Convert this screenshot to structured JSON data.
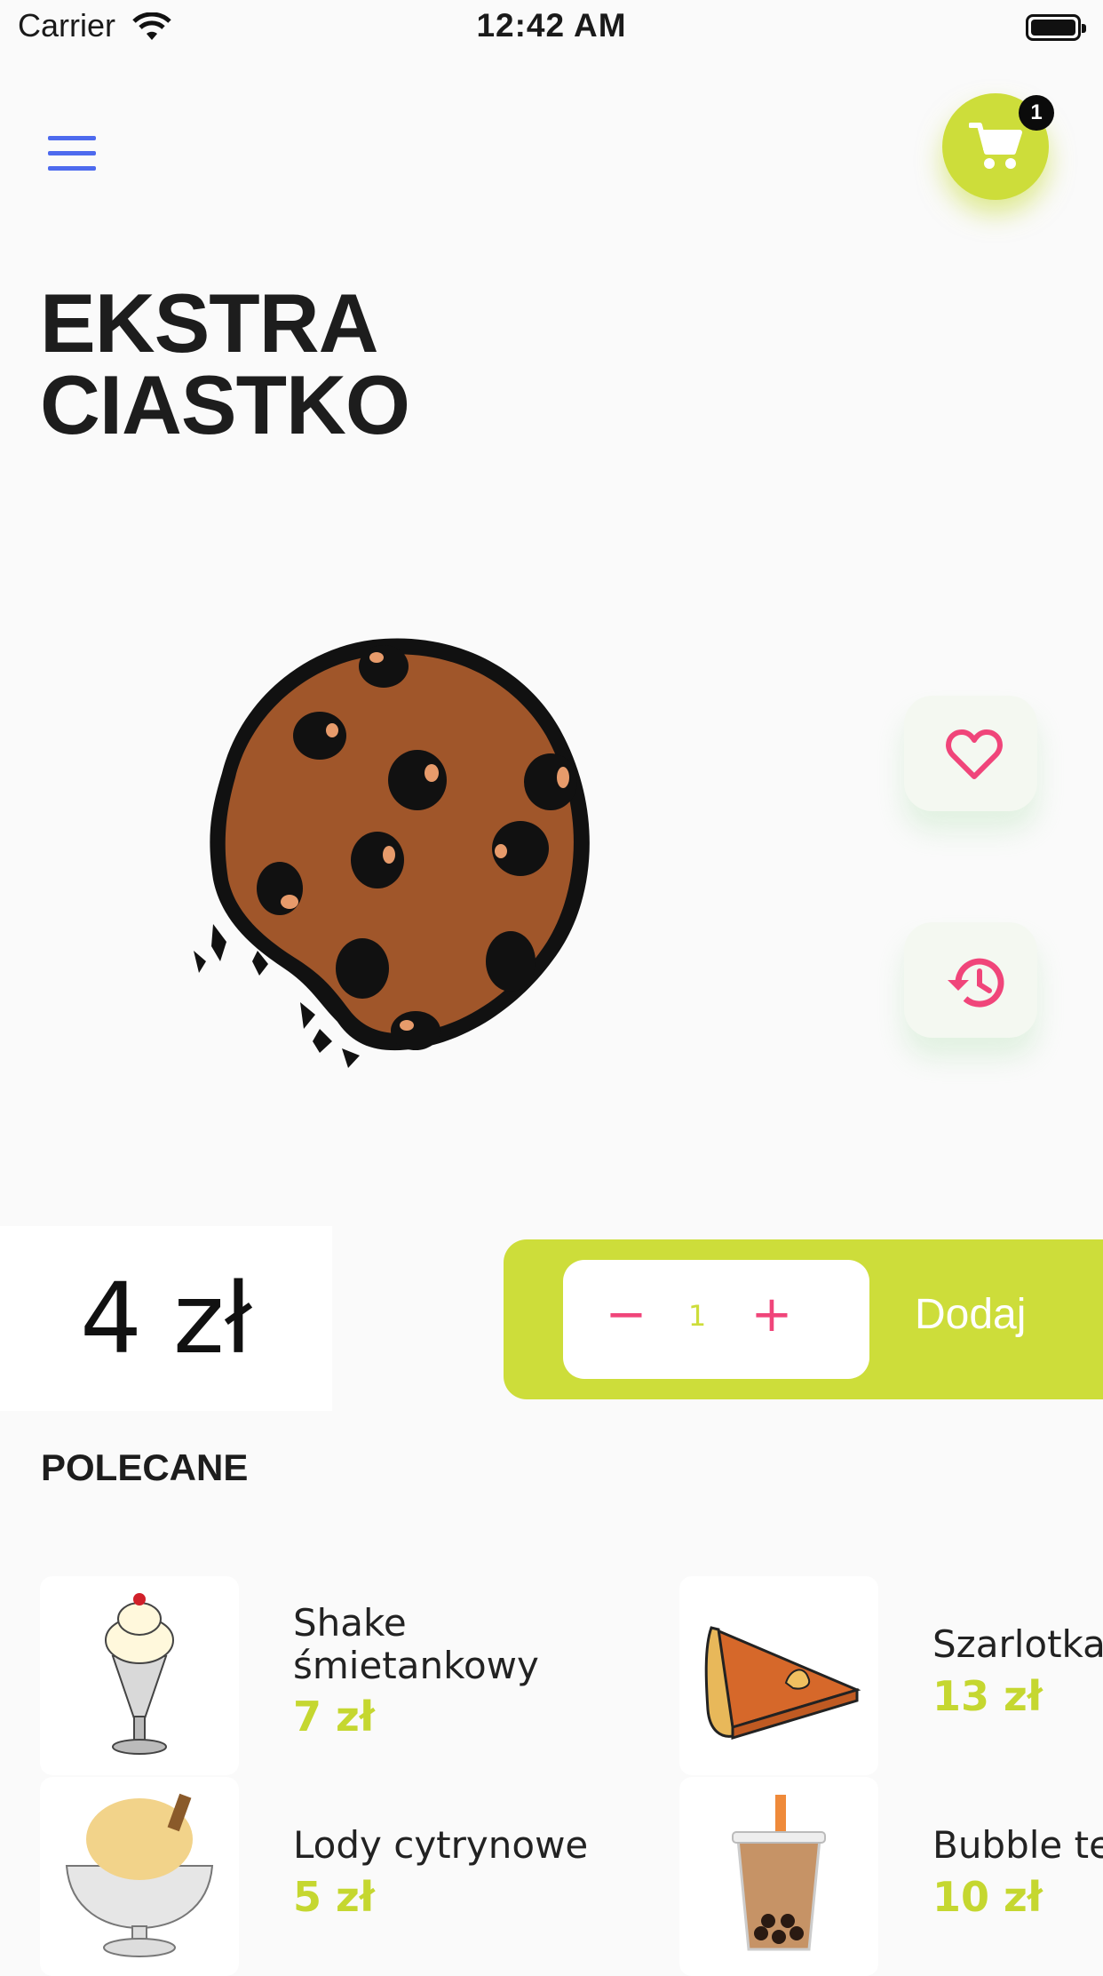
{
  "status_bar": {
    "carrier": "Carrier",
    "time": "12:42 AM"
  },
  "header": {
    "cart_count": "1"
  },
  "product": {
    "title_line1": "EKSTRA",
    "title_line2": "CIASTKO",
    "price": "4 zł"
  },
  "order": {
    "quantity": "1",
    "minus": "−",
    "plus": "+",
    "add_label": "Dodaj"
  },
  "recommended": {
    "heading": "POLECANE",
    "items": [
      {
        "name_line1": "Shake",
        "name_line2": "śmietankowy",
        "price": "7 zł"
      },
      {
        "name_line1": "Szarlotka",
        "price": "13 zł"
      },
      {
        "name_line1": "Lody cytrynowe",
        "price": "5 zł"
      },
      {
        "name_line1": "Bubble tea",
        "price": "10 zł"
      }
    ]
  },
  "colors": {
    "accent": "#cddd3a",
    "pink": "#f0457a",
    "menu_blue": "#4d6aee"
  },
  "icons": [
    "wifi-icon",
    "battery-icon",
    "menu-icon",
    "cart-icon",
    "heart-icon",
    "history-icon"
  ]
}
